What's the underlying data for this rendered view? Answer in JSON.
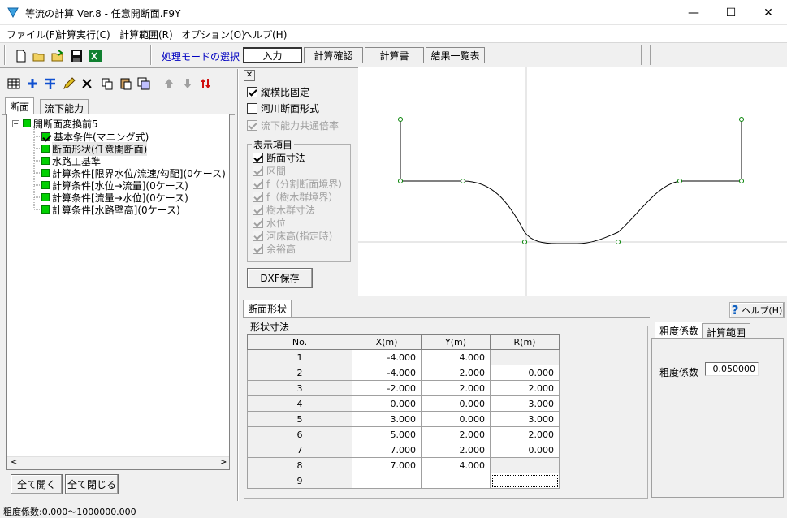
{
  "window": {
    "title": "等流の計算 Ver.8 - 任意開断面.F9Y",
    "minimize": "—",
    "maximize": "☐",
    "close": "✕"
  },
  "menu": [
    "ファイル(F)",
    "計算実行(C)",
    "計算範囲(R)",
    "オプション(O)",
    "ヘルプ(H)"
  ],
  "toolbar": {
    "mode_label": "処理モードの選択",
    "buttons": [
      "入力",
      "計算確認",
      "計算書",
      "結果一覧表"
    ]
  },
  "left": {
    "tabs": [
      "断面",
      "流下能力"
    ],
    "tree": {
      "root": "開断面変換前5",
      "items": [
        "基本条件(マニング式)",
        "断面形状(任意開断面)",
        "水路工基準",
        "計算条件[限界水位/流速/勾配](0ケース)",
        "計算条件[水位→流量](0ケース)",
        "計算条件[流量→水位](0ケース)",
        "計算条件[水路壁高](0ケース)"
      ]
    },
    "expand_all": "全て開く",
    "collapse_all": "全て閉じる"
  },
  "options": {
    "close_glyph": "✕",
    "fix_aspect": "縦横比固定",
    "river_section": "河川断面形式",
    "common_factor": "流下能力共通倍率",
    "display_group": "表示項目",
    "display_items": [
      "断面寸法",
      "区間",
      "f（分割断面境界）",
      "f（樹木群境界）",
      "樹木群寸法",
      "水位",
      "河床高(指定時)",
      "余裕高"
    ],
    "dxf": "DXF保存"
  },
  "bottom": {
    "tab": "断面形状",
    "help": "ヘルプ(H)",
    "group": "形状寸法",
    "headers": [
      "No.",
      "X(m)",
      "Y(m)",
      "R(m)"
    ],
    "rows": [
      {
        "no": "1",
        "x": "-4.000",
        "y": "4.000",
        "r": ""
      },
      {
        "no": "2",
        "x": "-4.000",
        "y": "2.000",
        "r": "0.000"
      },
      {
        "no": "3",
        "x": "-2.000",
        "y": "2.000",
        "r": "2.000"
      },
      {
        "no": "4",
        "x": "0.000",
        "y": "0.000",
        "r": "3.000"
      },
      {
        "no": "5",
        "x": "3.000",
        "y": "0.000",
        "r": "3.000"
      },
      {
        "no": "6",
        "x": "5.000",
        "y": "2.000",
        "r": "2.000"
      },
      {
        "no": "7",
        "x": "7.000",
        "y": "2.000",
        "r": "0.000"
      },
      {
        "no": "8",
        "x": "7.000",
        "y": "4.000",
        "r": ""
      },
      {
        "no": "9",
        "x": "",
        "y": "",
        "r": ""
      }
    ],
    "right_tabs": [
      "粗度係数",
      "計算範囲"
    ],
    "roughness_label": "粗度係数",
    "roughness_value": "0.050000"
  },
  "status": "粗度係数:0.000〜1000000.000",
  "colors": {
    "accent": "#0000c0",
    "node": "#00d000"
  }
}
